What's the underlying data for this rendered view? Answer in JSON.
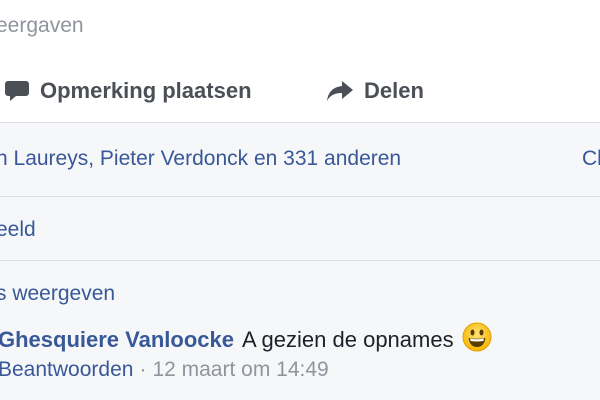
{
  "top_bar": {
    "text": "eergaven"
  },
  "actions": {
    "comment_label": "Opmerking plaatsen",
    "share_label": "Delen",
    "comment_icon": "speech-bubble-icon",
    "share_icon": "share-arrow-icon"
  },
  "likes": {
    "text": "n Laureys, Pieter Verdonck en 331 anderen",
    "right_text": "Cl"
  },
  "sort": {
    "text": "eeld"
  },
  "replies": {
    "more_text": "s weergeven"
  },
  "comment": {
    "author": "Ghesquiere Vanloocke",
    "text": "A gezien de opnames",
    "emoji": "grinning-face-emoji",
    "reply_label": "Beantwoorden",
    "separator": "·",
    "timestamp": "12 maart om 14:49"
  },
  "colors": {
    "link": "#385898",
    "secondary_text": "#90949c",
    "action_text": "#4b4f56",
    "divider": "#dddfe2",
    "comments_background": "#f6f7f9"
  }
}
